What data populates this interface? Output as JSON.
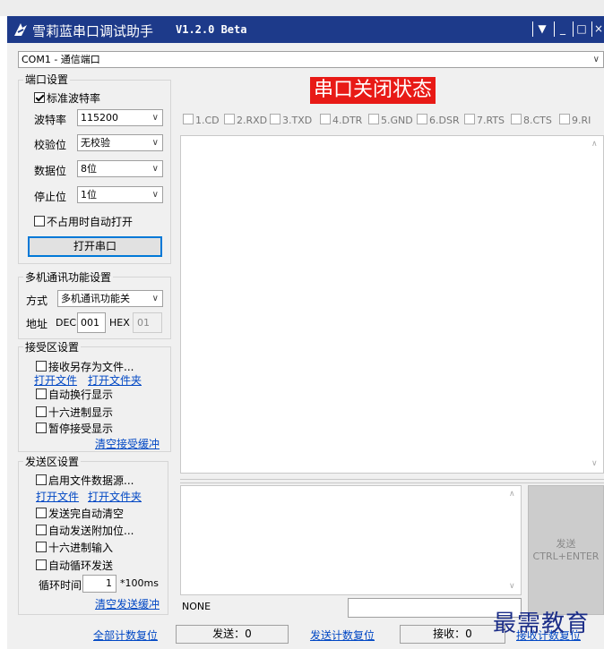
{
  "window": {
    "title": "雪莉蓝串口调试助手",
    "version": "V1.2.0 Beta",
    "controls": [
      "▼",
      "_",
      "□",
      "×"
    ]
  },
  "port_select": {
    "value": "COM1 - 通信端口"
  },
  "port_settings": {
    "title": "端口设置",
    "standard_baud": "标准波特率",
    "standard_baud_checked": true,
    "baud_label": "波特率",
    "baud_value": "115200",
    "parity_label": "校验位",
    "parity_value": "无校验",
    "databits_label": "数据位",
    "databits_value": "8位",
    "stopbits_label": "停止位",
    "stopbits_value": "1位",
    "auto_open": "不占用时自动打开",
    "open_button": "打开串口"
  },
  "multi": {
    "title": "多机通讯功能设置",
    "mode_label": "方式",
    "mode_value": "多机通讯功能关",
    "addr_label": "地址",
    "dec_label": "DEC",
    "dec_value": "001",
    "hex_label": "HEX",
    "hex_value": "01"
  },
  "receive": {
    "title": "接受区设置",
    "save_to_file": "接收另存为文件...",
    "open_file": "打开文件",
    "open_folder": "打开文件夹",
    "auto_newline": "自动换行显示",
    "hex_display": "十六进制显示",
    "pause_display": "暂停接受显示",
    "clear_buffer": "清空接受缓冲"
  },
  "send": {
    "title": "发送区设置",
    "file_source": "启用文件数据源...",
    "open_file": "打开文件",
    "open_folder": "打开文件夹",
    "auto_clear": "发送完自动清空",
    "append_bits": "自动发送附加位...",
    "hex_input": "十六进制输入",
    "loop_send": "自动循环发送",
    "loop_label": "循环时间",
    "loop_value": "1",
    "loop_unit": "*100ms",
    "clear_buffer": "清空发送缓冲",
    "send_button_line1": "发送",
    "send_button_line2": "CTRL+ENTER"
  },
  "status_banner": "串口关闭状态",
  "signals": [
    "1.CD",
    "2.RXD",
    "3.TXD",
    "4.DTR",
    "5.GND",
    "6.DSR",
    "7.RTS",
    "8.CTS",
    "9.RI"
  ],
  "footer": {
    "ending": "NONE",
    "reset_all": "全部计数复位",
    "sent_count": "发送：0",
    "reset_sent": "发送计数复位",
    "recv_count": "接收：0",
    "reset_recv": "接收计数复位"
  },
  "watermark": "最需教育",
  "colors": {
    "titlebar": "#1d3a8a",
    "status_banner": "#e81a16",
    "link": "#0047c4"
  }
}
